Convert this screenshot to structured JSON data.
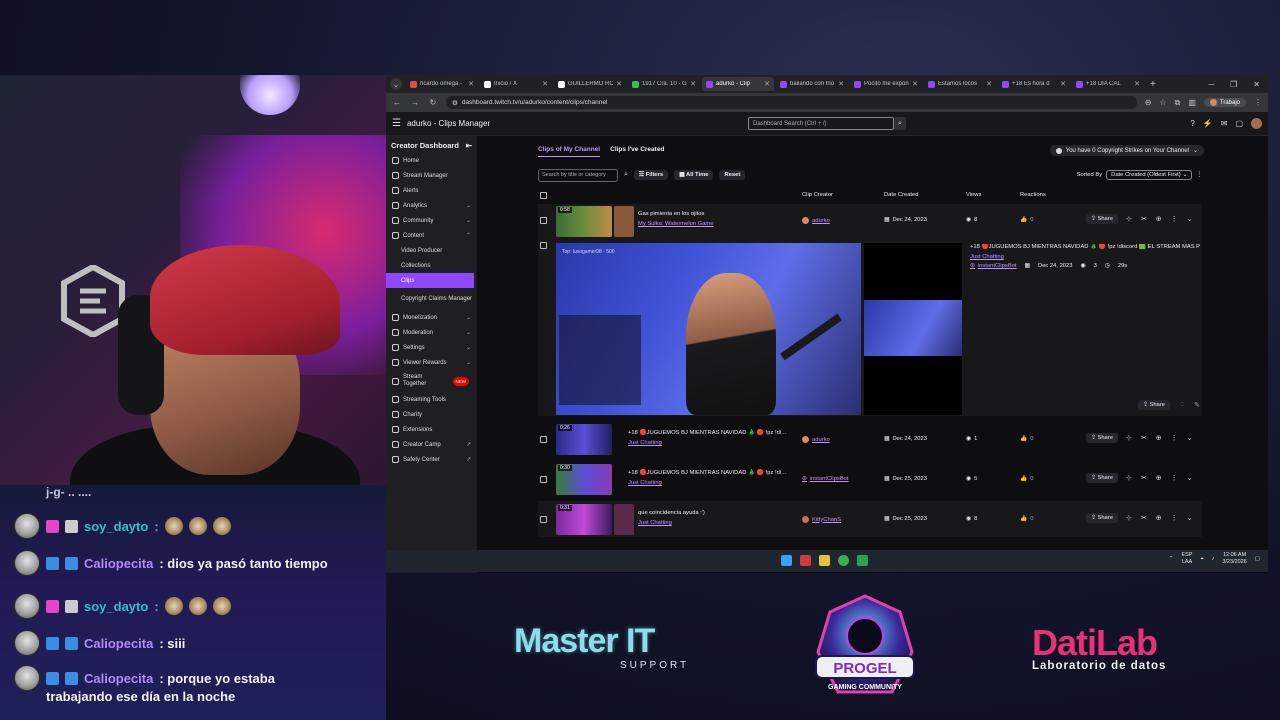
{
  "chat": {
    "top_fragment": "j-g- .. ....",
    "messages": [
      {
        "user": "soy_dayto",
        "text": ""
      },
      {
        "user": "Caliopecita",
        "text": ": dios ya pasó tanto tiempo"
      },
      {
        "user": "soy_dayto",
        "text": ""
      },
      {
        "user": "Caliopecita",
        "text": ": siii"
      },
      {
        "user": "Caliopecita",
        "text": ": porque yo estaba"
      }
    ],
    "wrap_line": "trabajando ese día en la noche"
  },
  "browser": {
    "tabs": [
      {
        "title": "ricardo omega -",
        "color": "#e34a4a"
      },
      {
        "title": "Inicio / X",
        "color": "#ffffff"
      },
      {
        "title": "GUILLERMO ROD",
        "color": "#ffffff"
      },
      {
        "title": "1917 Cra. 10 - Go",
        "color": "#2fbf55"
      },
      {
        "title": "adurko - Clip",
        "color": "#9147ff"
      },
      {
        "title": "bailando con frio",
        "color": "#9147ff"
      },
      {
        "title": "Pocito me expon",
        "color": "#9147ff"
      },
      {
        "title": "Estamos locos",
        "color": "#9147ff"
      },
      {
        "title": "+18 Es hora d",
        "color": "#9147ff"
      },
      {
        "title": "+18 DIA CAL",
        "color": "#9147ff"
      }
    ],
    "url": "dashboard.twitch.tv/u/adurko/content/clips/channel",
    "profile_label": "Trabajo"
  },
  "twitch": {
    "app_title": "adurko - Clips Manager",
    "search_placeholder": "Dashboard Search (Ctrl + /)",
    "sidebar": {
      "header": "Creator Dashboard",
      "items": [
        {
          "label": "Home"
        },
        {
          "label": "Stream Manager"
        },
        {
          "label": "Alerts"
        },
        {
          "label": "Analytics"
        },
        {
          "label": "Community"
        },
        {
          "label": "Content"
        },
        {
          "label": "Video Producer"
        },
        {
          "label": "Collections"
        },
        {
          "label": "Clips"
        },
        {
          "label": "Copyright Claims Manager"
        },
        {
          "label": "Monetization"
        },
        {
          "label": "Moderation"
        },
        {
          "label": "Settings"
        },
        {
          "label": "Viewer Rewards"
        },
        {
          "label": "Stream Together"
        },
        {
          "label": "Streaming Tools"
        },
        {
          "label": "Charity"
        },
        {
          "label": "Extensions"
        },
        {
          "label": "Creator Camp"
        },
        {
          "label": "Safety Center"
        }
      ],
      "new_badge": "NEW"
    },
    "tabs": [
      "Clips of My Channel",
      "Clips I've Created"
    ],
    "strikes": "You have 0 Copyright Strikes on Your Channel",
    "clip_search_placeholder": "Search by title or category",
    "filters_label": "Filters",
    "time_label": "All Time",
    "reset_label": "Reset",
    "sorted_by_label": "Sorted By",
    "sorted_value": "Date Created (Oldest First)",
    "columns": [
      "Clip Creator",
      "Date Created",
      "Views",
      "Reactions"
    ],
    "rows": [
      {
        "dur": "0:58",
        "title": "Gas pimienta en los ojitos",
        "category": "My Sulka: Watermelon Game",
        "creator": "adurko",
        "date": "Dec 24, 2023",
        "views": "8",
        "reactions": "0"
      },
      {
        "dur": "0:26",
        "title": "+18 🔴JUGUEMOS BJ MIENTRAS NAVIDAD 🎄 🔴 !pz !di...",
        "category": "Just Chatting",
        "creator": "adurko",
        "date": "Dec 24, 2023",
        "views": "1",
        "reactions": "0"
      },
      {
        "dur": "0:30",
        "title": "+18 🔴JUGUEMOS BJ MIENTRAS NAVIDAD 🎄 🔴 !pz !di...",
        "category": "Just Chatting",
        "creator": "instantClipsBot",
        "date": "Dec 25, 2023",
        "views": "5",
        "reactions": "0"
      },
      {
        "dur": "0:31",
        "title": "que coincidencia ayuda :')",
        "category": "Just Chatting",
        "creator": "KittyChanS",
        "date": "Dec 25, 2023",
        "views": "8",
        "reactions": "0"
      }
    ],
    "expanded": {
      "title": "+18 🔴JUGUEMOS BJ MIENTRAS NAVIDAD 🎄 🔴 !pz !discord 🟩 EL STREAM MÁS P",
      "category": "Just Chatting",
      "creator": "instantClipsBot",
      "date": "Dec 24, 2023",
      "views": "3",
      "duration": "29s",
      "player_label": "Top: luxogamer98 - 500"
    },
    "share_label": "Share"
  },
  "taskbar": {
    "lang": "ESP",
    "lang_sub": "LAA",
    "time": "12:06 AM",
    "date": "3/23/2026"
  },
  "sponsors": {
    "master_word": "Master IT",
    "master_sub": "SUPPORT",
    "progel_name": "PROGEL",
    "progel_sub": "GAMING COMMUNITY",
    "dati_word": "DatiLab",
    "dati_sub": "Laboratorio de datos"
  }
}
